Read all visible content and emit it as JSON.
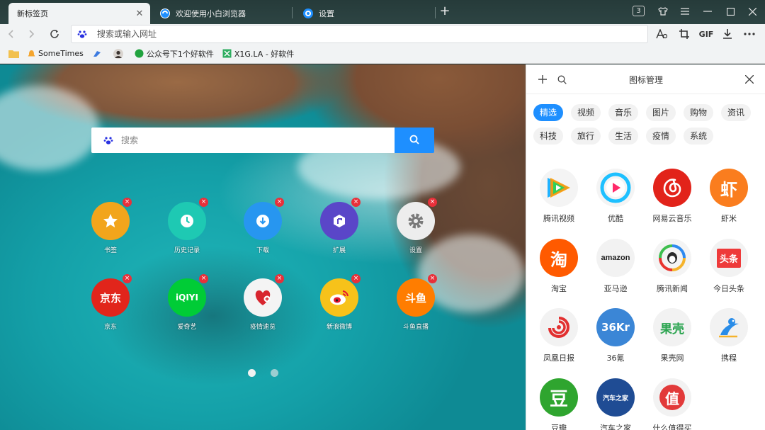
{
  "tabs": [
    {
      "title": "新标签页",
      "active": true
    },
    {
      "title": "欢迎使用小白浏览器",
      "active": false
    },
    {
      "title": "设置",
      "active": false
    }
  ],
  "tab_count": "3",
  "address": {
    "placeholder": "搜索或输入网址"
  },
  "toolbar": {
    "gif_label": "GIF"
  },
  "bookmarks": [
    {
      "label": "SomeTimes",
      "icon": "bell-icon"
    },
    {
      "label": "",
      "icon": "link-icon"
    },
    {
      "label": "",
      "icon": "avatar-icon"
    },
    {
      "label": "公众号下1个好软件",
      "icon": "green-dot-icon"
    },
    {
      "label": "X1G.LA - 好软件",
      "icon": "x1g-icon"
    }
  ],
  "search": {
    "placeholder": "搜索"
  },
  "tiles": [
    {
      "label": "书签",
      "icon": "star-icon",
      "color": "#f2a51c"
    },
    {
      "label": "历史记录",
      "icon": "clock-icon",
      "color": "#1ec9b3"
    },
    {
      "label": "下载",
      "icon": "download-icon",
      "color": "#2796f0"
    },
    {
      "label": "扩展",
      "icon": "extension-icon",
      "color": "#5a46c8"
    },
    {
      "label": "设置",
      "icon": "gear-icon",
      "color": "#8d8d8d"
    },
    {
      "label": "京东",
      "icon": "jd-logo",
      "color": "#e1251b",
      "text": "京东"
    },
    {
      "label": "爱奇艺",
      "icon": "iqiyi-logo",
      "color": "#00cc36",
      "text": "iQIYI"
    },
    {
      "label": "疫情速览",
      "icon": "heart-icon",
      "color": "#f4f4f4"
    },
    {
      "label": "新浪微博",
      "icon": "weibo-logo",
      "color": "#f7c21a"
    },
    {
      "label": "斗鱼直播",
      "icon": "douyu-logo",
      "color": "#ff7d00",
      "text": "斗鱼"
    }
  ],
  "page_dots": {
    "count": 2,
    "active": 0
  },
  "panel": {
    "title": "图标管理",
    "categories": [
      "精选",
      "视频",
      "音乐",
      "图片",
      "购物",
      "资讯",
      "科技",
      "旅行",
      "生活",
      "疫情",
      "系统"
    ],
    "active_category": "精选",
    "apps": [
      {
        "label": "腾讯视频",
        "icon": "tencent-video-logo",
        "color": "#f4f4f4"
      },
      {
        "label": "优酷",
        "icon": "youku-logo",
        "color": "#f4f4f4"
      },
      {
        "label": "网易云音乐",
        "icon": "netease-music-logo",
        "color": "#e2231a"
      },
      {
        "label": "虾米",
        "icon": "xiami-logo",
        "color": "#fa7d1e",
        "text": "虾"
      },
      {
        "label": "淘宝",
        "icon": "taobao-logo",
        "color": "#ff5a00",
        "text": "淘"
      },
      {
        "label": "亚马逊",
        "icon": "amazon-logo",
        "color": "#f2f2f2",
        "text": "amazon"
      },
      {
        "label": "腾讯新闻",
        "icon": "tencent-news-logo",
        "color": "#f4f4f4"
      },
      {
        "label": "今日头条",
        "icon": "toutiao-logo",
        "color": "#f2f2f2",
        "text": "头条"
      },
      {
        "label": "凤凰日报",
        "icon": "ifeng-logo",
        "color": "#f2f2f2"
      },
      {
        "label": "36氪",
        "icon": "36kr-logo",
        "color": "#3b86d6",
        "text": "36Kr"
      },
      {
        "label": "果壳网",
        "icon": "guokr-logo",
        "color": "#f2f2f2",
        "text": "果壳"
      },
      {
        "label": "携程",
        "icon": "ctrip-logo",
        "color": "#f2f2f2"
      },
      {
        "label": "豆瓣",
        "icon": "douban-logo",
        "color": "#2fa52f",
        "text": "豆"
      },
      {
        "label": "汽车之家",
        "icon": "autohome-logo",
        "color": "#1f4c94",
        "text": "汽车之家"
      },
      {
        "label": "什么值得买",
        "icon": "smzdm-logo",
        "color": "#f2f2f2",
        "text": "值"
      }
    ]
  }
}
